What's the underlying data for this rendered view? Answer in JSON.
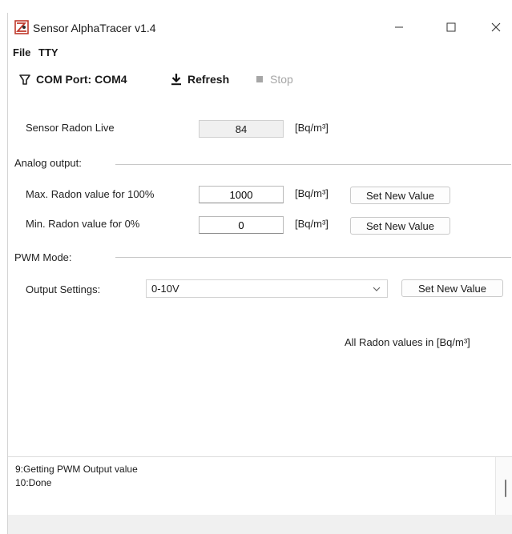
{
  "window": {
    "title": "Sensor AlphaTracer v1.4",
    "icon": "app-logo-icon"
  },
  "menu": {
    "items": [
      {
        "label": "File"
      },
      {
        "label": "TTY"
      }
    ]
  },
  "toolbar": {
    "com_port": {
      "label": "COM Port: COM4",
      "icon": "plug-icon"
    },
    "refresh": {
      "label": "Refresh",
      "icon": "download-arrow-icon"
    },
    "stop": {
      "label": "Stop",
      "icon": "stop-square-icon",
      "enabled": false
    }
  },
  "live": {
    "label": "Sensor Radon Live",
    "value": "84",
    "unit": "[Bq/m³]"
  },
  "analog": {
    "group_label": "Analog output:",
    "max": {
      "label": "Max. Radon value for 100%",
      "value": "1000",
      "unit": "[Bq/m³]",
      "button": "Set New Value"
    },
    "min": {
      "label": "Min. Radon value for 0%",
      "value": "0",
      "unit": "[Bq/m³]",
      "button": "Set New Value"
    }
  },
  "pwm": {
    "group_label": "PWM Mode:",
    "output_label": "Output Settings:",
    "output_value": "0-10V",
    "button": "Set New Value"
  },
  "note": "All Radon values in [Bq/m³]",
  "log": {
    "lines": [
      "9:Getting PWM Output value",
      "10:Done"
    ]
  },
  "colors": {
    "disabled": "#a6a6a6",
    "status_bar": "#f0f0f0",
    "accent_icon": "#c0392b"
  }
}
